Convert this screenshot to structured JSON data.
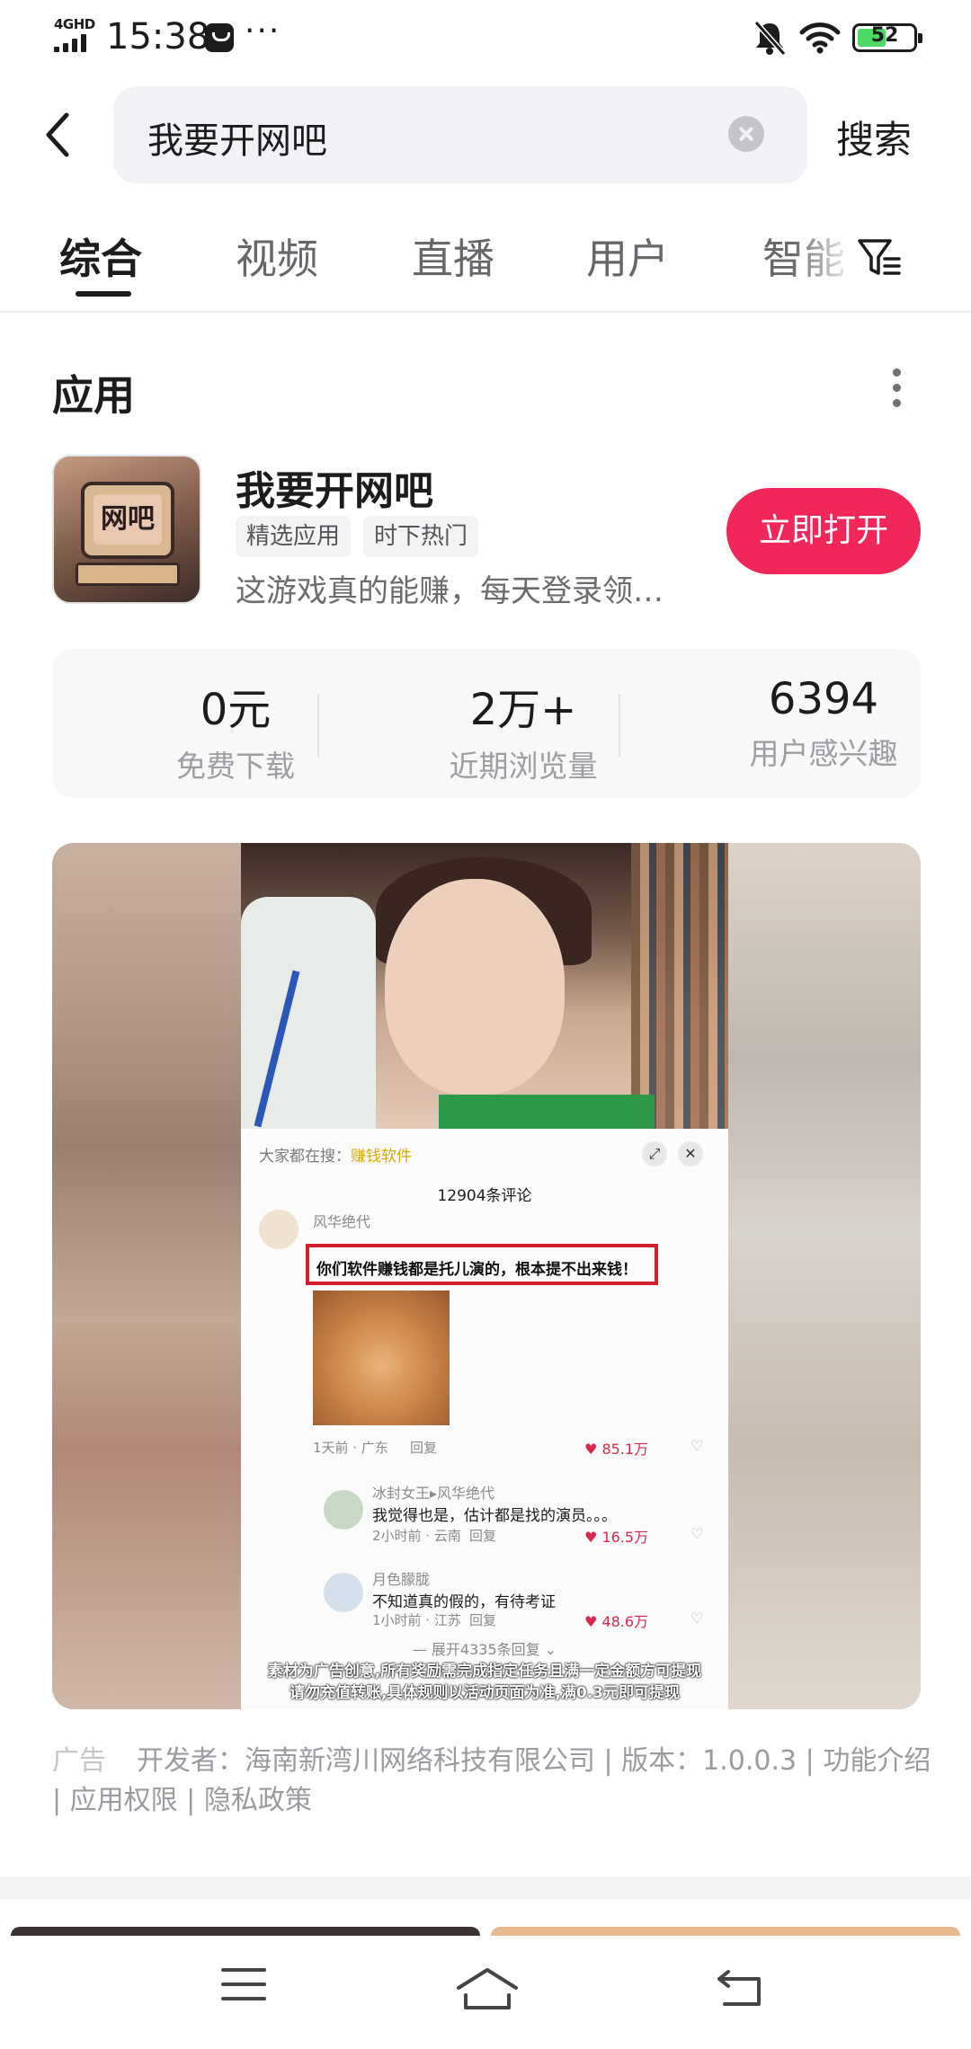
{
  "status_bar": {
    "network": "4GHD",
    "time": "15:38",
    "more": "···",
    "battery": "52",
    "battery_level": 0.52
  },
  "search": {
    "query": "我要开网吧",
    "submit_label": "搜索"
  },
  "tabs": [
    "综合",
    "视频",
    "直播",
    "用户",
    "智能"
  ],
  "active_tab": 0,
  "section": {
    "title": "应用"
  },
  "app": {
    "icon_text": "网吧",
    "name": "我要开网吧",
    "tags": [
      "精选应用",
      "时下热门"
    ],
    "description": "这游戏真的能赚，每天登录领…",
    "open_label": "立即打开",
    "open_color": "#f1275a"
  },
  "stats": [
    {
      "value": "0元",
      "label": "免费下载"
    },
    {
      "value": "2万+",
      "label": "近期浏览量"
    },
    {
      "value": "6394",
      "label": "用户感兴趣"
    }
  ],
  "video": {
    "hot_prefix": "大家都在搜：",
    "hot_term": "赚钱软件",
    "comment_count": "12904条评论",
    "comments": [
      {
        "user": "风华绝代",
        "text": "你们软件赚钱都是托儿演的，根本提不出来钱！",
        "meta": "1天前 · 广东",
        "reply": "回复",
        "likes": "85.1万"
      },
      {
        "user": "冰封女王▸风华绝代",
        "text": "我觉得也是，估计都是找的演员。。。",
        "meta": "2小时前 · 云南",
        "reply": "回复",
        "likes": "16.5万"
      },
      {
        "user": "月色朦胧",
        "text": "不知道真的假的，有待考证",
        "meta": "1小时前 · 江苏",
        "reply": "回复",
        "likes": "48.6万"
      }
    ],
    "expand": "展开4335条回复",
    "subtitle_line1": "素材为广告创意,所有奖励需完成指定任务且满一定金额方可提现",
    "subtitle_line2": "请勿充值转账,具体规则以活动页面为准,满0.3元即可提现"
  },
  "ad_info": {
    "label": "广告",
    "text": "开发者：海南新湾川网络科技有限公司 | 版本：1.0.0.3 | 功能介绍 | 应用权限 | 隐私政策"
  }
}
